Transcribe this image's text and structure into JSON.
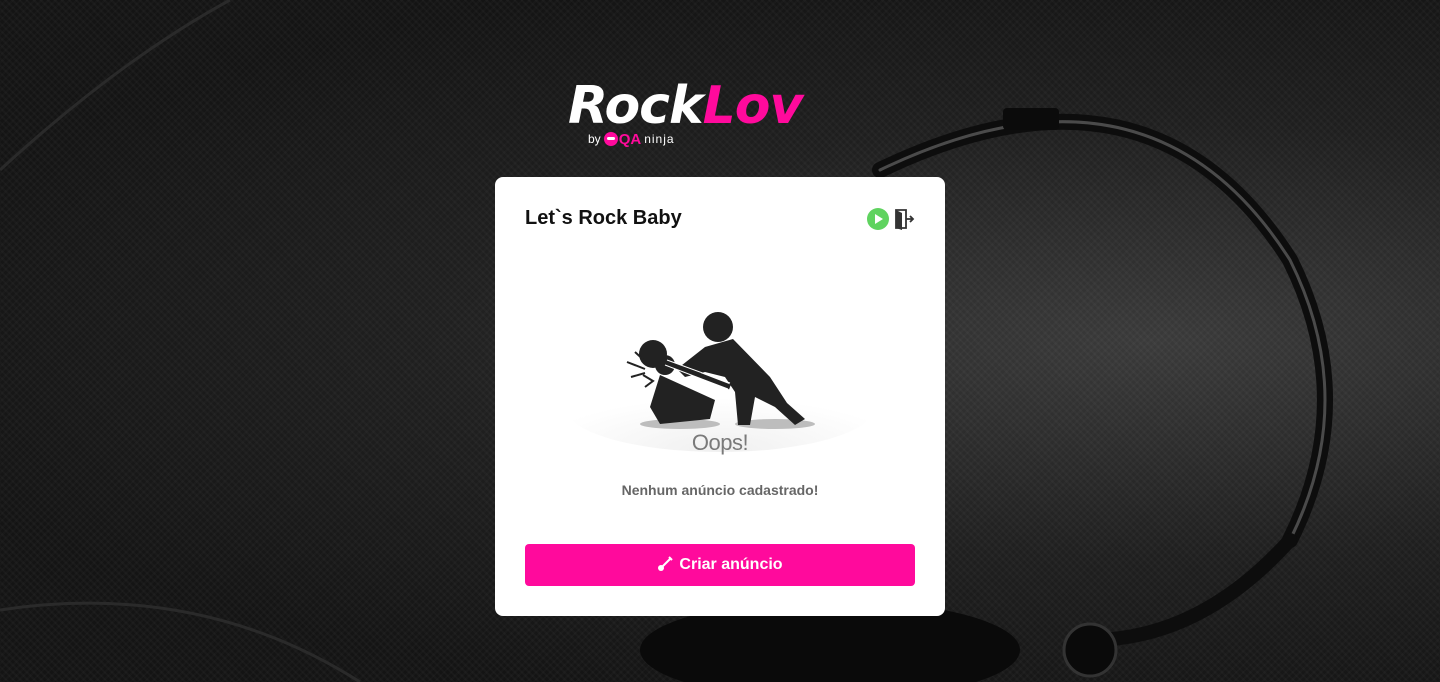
{
  "logo": {
    "rock": "Rock",
    "lov": "Lov",
    "by": "by",
    "qa": "QA",
    "ninja": "ninja"
  },
  "card": {
    "title": "Let`s Rock Baby",
    "oops": "Oops!",
    "empty_message": "Nenhum anúncio cadastrado!",
    "create_button_label": "Criar anúncio"
  },
  "icons": {
    "play": "play-circle-icon",
    "logout": "logout-icon",
    "guitar": "guitar-icon"
  },
  "colors": {
    "brand_pink": "#ff0a9c",
    "play_green": "#5fd35f",
    "card_bg": "#ffffff"
  }
}
